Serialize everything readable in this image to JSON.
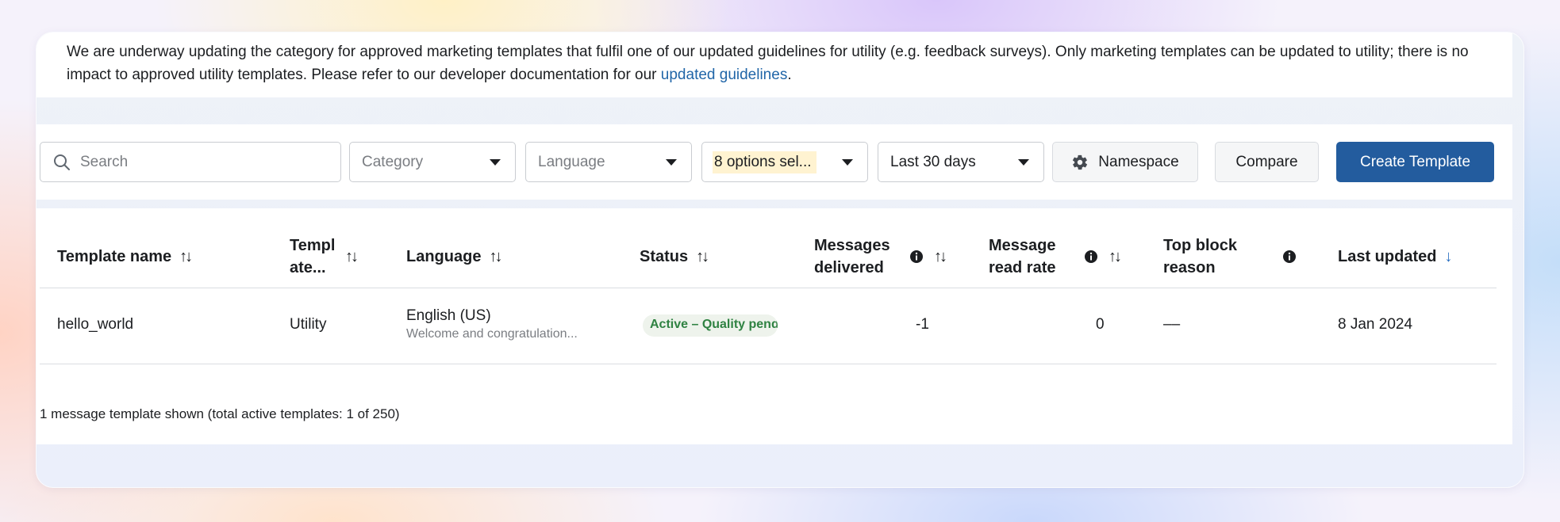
{
  "notice": {
    "text_before": "We are underway updating the category for approved marketing templates that fulfil one of our updated guidelines for utility (e.g. feedback surveys). Only marketing templates can be updated to utility; there is no impact to approved utility templates. Please refer to our developer documentation for our ",
    "link_text": "updated guidelines",
    "text_after": "."
  },
  "toolbar": {
    "search_placeholder": "Search",
    "category_label": "Category",
    "language_label": "Language",
    "status_filter_label": "8 options sel...",
    "date_range_label": "Last 30 days",
    "namespace_label": "Namespace",
    "compare_label": "Compare",
    "create_label": "Create Template"
  },
  "table": {
    "headers": {
      "name": "Template name",
      "category_line1": "Templ",
      "category_line2": "ate...",
      "language": "Language",
      "status": "Status",
      "delivered_line1": "Messages",
      "delivered_line2": "delivered",
      "read_rate_line1": "Message",
      "read_rate_line2": "read rate",
      "block_line1": "Top block",
      "block_line2": "reason",
      "last_updated": "Last updated"
    },
    "rows": [
      {
        "name": "hello_world",
        "category": "Utility",
        "language": "English (US)",
        "preview": "Welcome and congratulation...",
        "status": "Active – Quality pending",
        "delivered": "-1",
        "read_rate": "0",
        "block_reason": "––",
        "last_updated": "8 Jan 2024"
      }
    ]
  },
  "footer_text": "1 message template shown (total active templates: 1 of 250)",
  "icons": {
    "search": "search-icon",
    "gear": "gear-icon",
    "info": "info-icon",
    "sort": "sort-icon",
    "caret": "caret-down-icon"
  },
  "colors": {
    "primary_button": "#235c9e",
    "link": "#2166a8",
    "status_badge_text": "#2f8242",
    "status_badge_bg": "#eef3ec",
    "filter_highlight": "#fff3d1"
  }
}
